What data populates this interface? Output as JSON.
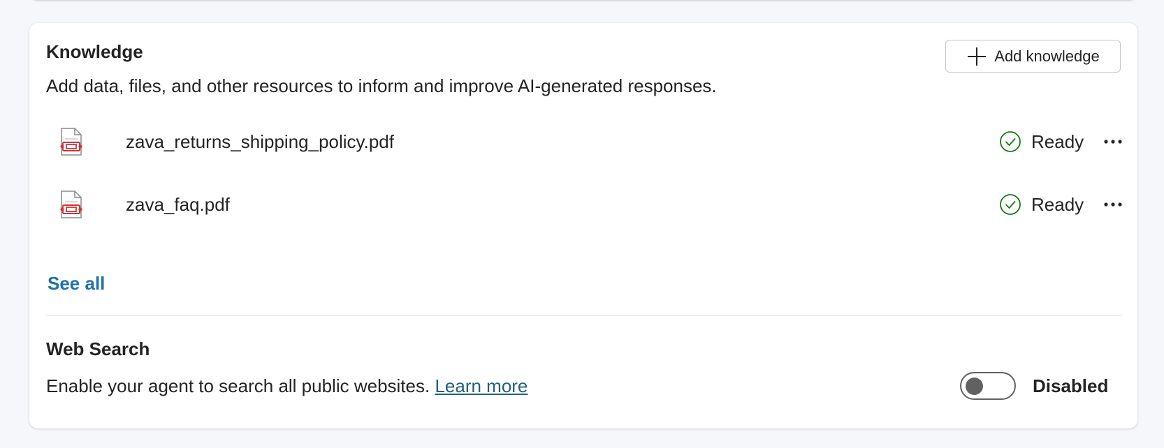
{
  "knowledge": {
    "title": "Knowledge",
    "description": "Add data, files, and other resources to inform and improve AI-generated responses.",
    "add_button_label": "Add knowledge",
    "files": [
      {
        "name": "zava_returns_shipping_policy.pdf",
        "status": "Ready",
        "icon": "pdf-file-icon"
      },
      {
        "name": "zava_faq.pdf",
        "status": "Ready",
        "icon": "pdf-file-icon"
      }
    ],
    "see_all_label": "See all"
  },
  "web_search": {
    "title": "Web Search",
    "description": "Enable your agent to search all public websites.",
    "learn_more_label": "Learn more",
    "toggle_state": "Disabled",
    "enabled": false
  },
  "colors": {
    "status_ready": "#107c10",
    "pdf_accent": "#d13438",
    "link": "#1f72a8"
  }
}
